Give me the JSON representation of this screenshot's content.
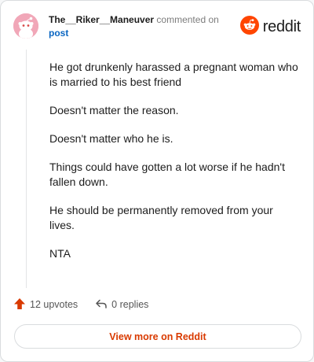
{
  "author": {
    "username": "The__Riker__Maneuver",
    "action_text": "commented on",
    "post_link": "post",
    "avatar_icon": "snoo-avatar-icon"
  },
  "brand": {
    "name": "reddit",
    "logo_icon": "reddit-logo-icon",
    "color": "#ff4500"
  },
  "comment": {
    "paragraphs": [
      "He got drunkenly harassed a pregnant woman who is married to his best friend",
      "Doesn't matter the reason.",
      "Doesn't matter who he is.",
      "Things could have gotten a lot worse if he hadn't fallen down.",
      "He should be permanently removed from your lives.",
      "NTA"
    ]
  },
  "actions": {
    "upvotes_label": "12 upvotes",
    "upvote_icon": "upvote-arrow-icon",
    "replies_label": "0 replies",
    "reply_icon": "reply-arrow-icon"
  },
  "footer": {
    "view_more_label": "View more on Reddit"
  },
  "colors": {
    "accent": "#d93a00",
    "link": "#0a66c2",
    "avatar_bg": "#f1a7b8"
  }
}
